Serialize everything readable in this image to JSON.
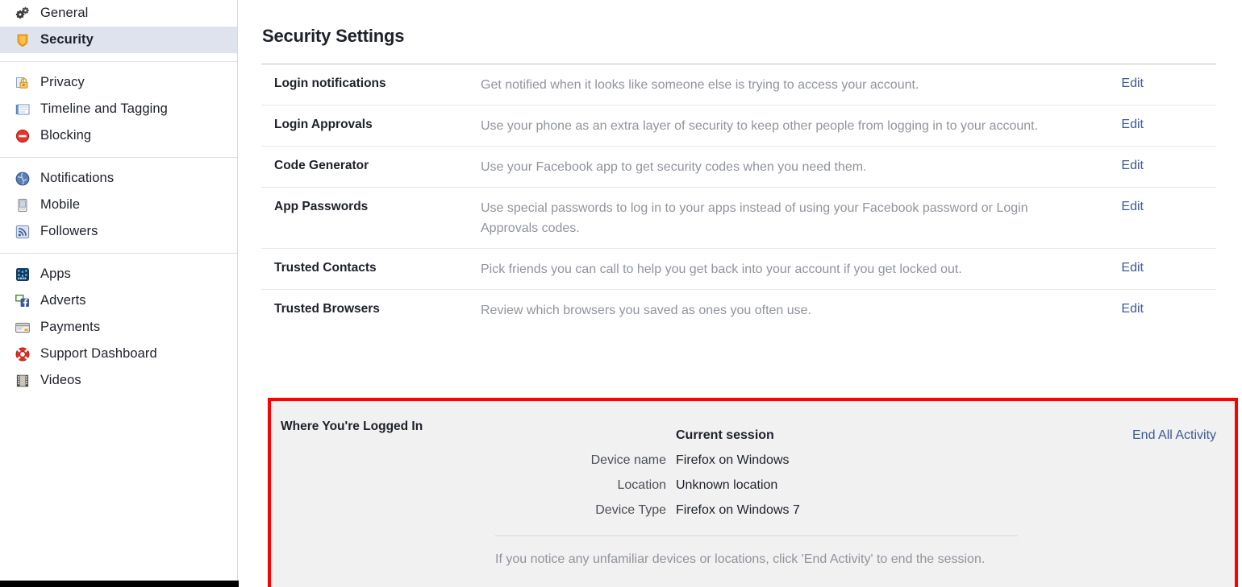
{
  "sidebar": {
    "groups": [
      {
        "items": [
          {
            "label": "General",
            "icon": "gears-icon",
            "active": false
          },
          {
            "label": "Security",
            "icon": "shield-icon",
            "active": true
          }
        ]
      },
      {
        "items": [
          {
            "label": "Privacy",
            "icon": "lock-icon",
            "active": false
          },
          {
            "label": "Timeline and Tagging",
            "icon": "timeline-icon",
            "active": false
          },
          {
            "label": "Blocking",
            "icon": "block-icon",
            "active": false
          }
        ]
      },
      {
        "items": [
          {
            "label": "Notifications",
            "icon": "globe-icon",
            "active": false
          },
          {
            "label": "Mobile",
            "icon": "mobile-icon",
            "active": false
          },
          {
            "label": "Followers",
            "icon": "rss-icon",
            "active": false
          }
        ]
      },
      {
        "items": [
          {
            "label": "Apps",
            "icon": "apps-icon",
            "active": false
          },
          {
            "label": "Adverts",
            "icon": "adverts-icon",
            "active": false
          },
          {
            "label": "Payments",
            "icon": "credit-card-icon",
            "active": false
          },
          {
            "label": "Support Dashboard",
            "icon": "lifebuoy-icon",
            "active": false
          },
          {
            "label": "Videos",
            "icon": "film-icon",
            "active": false
          }
        ]
      }
    ]
  },
  "main": {
    "title": "Security Settings",
    "rows": [
      {
        "label": "Login notifications",
        "desc": "Get notified when it looks like someone else is trying to access your account.",
        "action": "Edit"
      },
      {
        "label": "Login Approvals",
        "desc": "Use your phone as an extra layer of security to keep other people from logging in to your account.",
        "action": "Edit"
      },
      {
        "label": "Code Generator",
        "desc": "Use your Facebook app to get security codes when you need them.",
        "action": "Edit"
      },
      {
        "label": "App Passwords",
        "desc": "Use special passwords to log in to your apps instead of using your Facebook password or Login Approvals codes.",
        "action": "Edit"
      },
      {
        "label": "Trusted Contacts",
        "desc": "Pick friends you can call to help you get back into your account if you get locked out.",
        "action": "Edit"
      },
      {
        "label": "Trusted Browsers",
        "desc": "Review which browsers you saved as ones you often use.",
        "action": "Edit"
      }
    ]
  },
  "logged_in": {
    "title": "Where You're Logged In",
    "session_header": "Current session",
    "end_all_label": "End All Activity",
    "fields": [
      {
        "key": "Device name",
        "value": "Firefox on Windows"
      },
      {
        "key": "Location",
        "value": "Unknown location"
      },
      {
        "key": "Device Type",
        "value": "Firefox on Windows 7"
      }
    ],
    "note": "If you notice any unfamiliar devices or locations, click 'End Activity' to end the session."
  },
  "colors": {
    "accent_link": "#3b5998",
    "highlight_border": "#fe0000",
    "active_row_bg": "#dfe3ee",
    "panel_bg": "#f1f1f1",
    "muted_text": "#90949c"
  }
}
